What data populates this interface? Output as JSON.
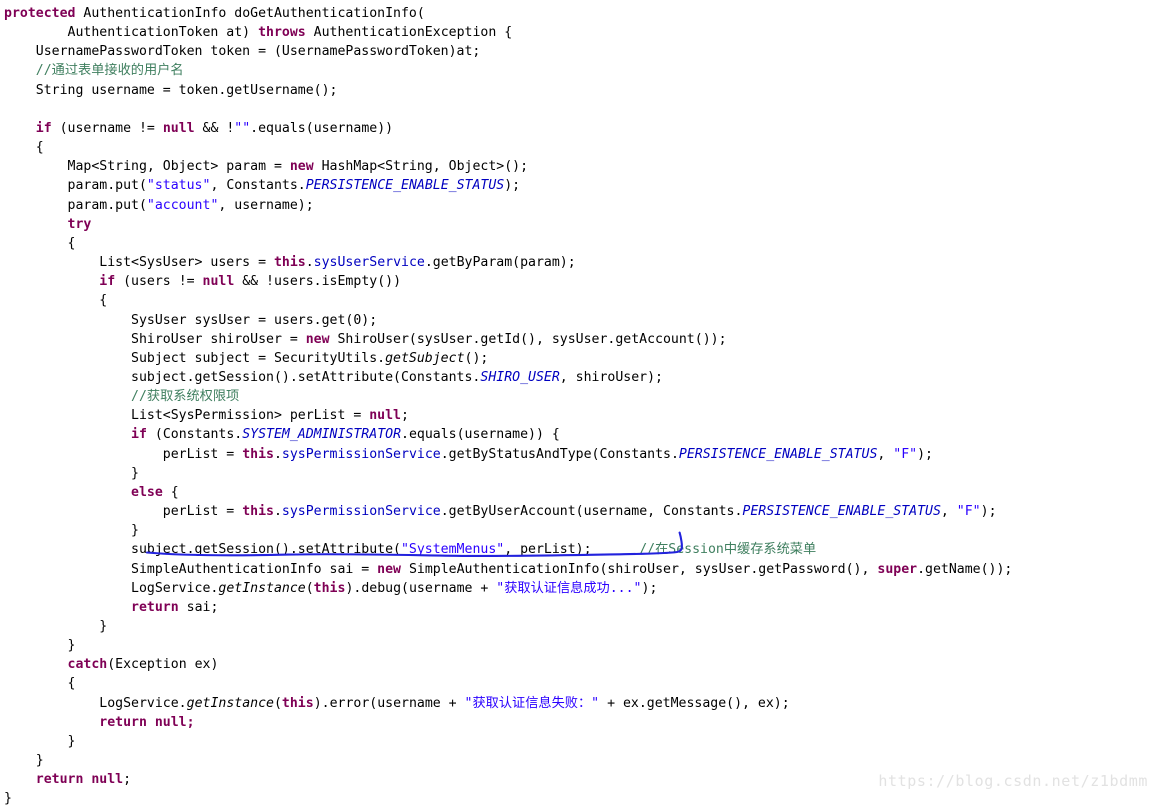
{
  "editor": {
    "language": "java",
    "background_color": "#ffffff",
    "default_text_color": "#000000",
    "theme": {
      "keyword_color": "#7F0055",
      "string_color": "#2A00FF",
      "comment_color": "#3F7F5F",
      "field_color": "#0000C0",
      "static_constant_color": "#0000C0"
    }
  },
  "annotation": {
    "ink_color": "#2222dd",
    "target_line_index": 28,
    "target_line_text": "subject.getSession().setAttribute(\"SystemMenus\", perList);",
    "shape": "hand-drawn-underline"
  },
  "watermark": {
    "text": "https://blog.csdn.net/z1bdmm",
    "color": "#e2e2e2"
  },
  "code": {
    "lines": [
      [
        {
          "t": "protected",
          "c": "kw"
        },
        {
          "t": " AuthenticationInfo doGetAuthenticationInfo(",
          "c": "plain"
        }
      ],
      [
        {
          "t": "        AuthenticationToken at) ",
          "c": "plain"
        },
        {
          "t": "throws",
          "c": "kw"
        },
        {
          "t": " AuthenticationException {",
          "c": "plain"
        }
      ],
      [
        {
          "t": "    UsernamePasswordToken token = (UsernamePasswordToken)at;",
          "c": "plain"
        }
      ],
      [
        {
          "t": "    //通过表单接收的用户名",
          "c": "cmt"
        }
      ],
      [
        {
          "t": "    String username = token.getUsername();",
          "c": "plain"
        }
      ],
      [
        {
          "t": "",
          "c": "plain"
        }
      ],
      [
        {
          "t": "    ",
          "c": "plain"
        },
        {
          "t": "if",
          "c": "kw"
        },
        {
          "t": " (username != ",
          "c": "plain"
        },
        {
          "t": "null",
          "c": "kw"
        },
        {
          "t": " && !",
          "c": "plain"
        },
        {
          "t": "\"\"",
          "c": "str"
        },
        {
          "t": ".equals(username))",
          "c": "plain"
        }
      ],
      [
        {
          "t": "    {",
          "c": "plain"
        }
      ],
      [
        {
          "t": "        Map<String, Object> param = ",
          "c": "plain"
        },
        {
          "t": "new",
          "c": "kw"
        },
        {
          "t": " HashMap<String, Object>();",
          "c": "plain"
        }
      ],
      [
        {
          "t": "        param.put(",
          "c": "plain"
        },
        {
          "t": "\"status\"",
          "c": "str"
        },
        {
          "t": ", Constants.",
          "c": "plain"
        },
        {
          "t": "PERSISTENCE_ENABLE_STATUS",
          "c": "cnst"
        },
        {
          "t": ");",
          "c": "plain"
        }
      ],
      [
        {
          "t": "        param.put(",
          "c": "plain"
        },
        {
          "t": "\"account\"",
          "c": "str"
        },
        {
          "t": ", username);",
          "c": "plain"
        }
      ],
      [
        {
          "t": "        ",
          "c": "plain"
        },
        {
          "t": "try",
          "c": "kw"
        }
      ],
      [
        {
          "t": "        {",
          "c": "plain"
        }
      ],
      [
        {
          "t": "            List<SysUser> users = ",
          "c": "plain"
        },
        {
          "t": "this",
          "c": "kw"
        },
        {
          "t": ".",
          "c": "plain"
        },
        {
          "t": "sysUserService",
          "c": "fld"
        },
        {
          "t": ".getByParam(param);",
          "c": "plain"
        }
      ],
      [
        {
          "t": "            ",
          "c": "plain"
        },
        {
          "t": "if",
          "c": "kw"
        },
        {
          "t": " (users != ",
          "c": "plain"
        },
        {
          "t": "null",
          "c": "kw"
        },
        {
          "t": " && !users.isEmpty())",
          "c": "plain"
        }
      ],
      [
        {
          "t": "            {",
          "c": "plain"
        }
      ],
      [
        {
          "t": "                SysUser sysUser = users.get(0);",
          "c": "plain"
        }
      ],
      [
        {
          "t": "                ShiroUser shiroUser = ",
          "c": "plain"
        },
        {
          "t": "new",
          "c": "kw"
        },
        {
          "t": " ShiroUser(sysUser.getId(), sysUser.getAccount());",
          "c": "plain"
        }
      ],
      [
        {
          "t": "                Subject subject = SecurityUtils.",
          "c": "plain"
        },
        {
          "t": "getSubject",
          "c": "stmeth"
        },
        {
          "t": "();",
          "c": "plain"
        }
      ],
      [
        {
          "t": "                subject.getSession().setAttribute(Constants.",
          "c": "plain"
        },
        {
          "t": "SHIRO_USER",
          "c": "cnst"
        },
        {
          "t": ", shiroUser);",
          "c": "plain"
        }
      ],
      [
        {
          "t": "                //获取系统权限项",
          "c": "cmt"
        }
      ],
      [
        {
          "t": "                List<SysPermission> perList = ",
          "c": "plain"
        },
        {
          "t": "null",
          "c": "kw"
        },
        {
          "t": ";",
          "c": "plain"
        }
      ],
      [
        {
          "t": "                ",
          "c": "plain"
        },
        {
          "t": "if",
          "c": "kw"
        },
        {
          "t": " (Constants.",
          "c": "plain"
        },
        {
          "t": "SYSTEM_ADMINISTRATOR",
          "c": "cnst"
        },
        {
          "t": ".equals(username)) {",
          "c": "plain"
        }
      ],
      [
        {
          "t": "                    perList = ",
          "c": "plain"
        },
        {
          "t": "this",
          "c": "kw"
        },
        {
          "t": ".",
          "c": "plain"
        },
        {
          "t": "sysPermissionService",
          "c": "fld"
        },
        {
          "t": ".getByStatusAndType(Constants.",
          "c": "plain"
        },
        {
          "t": "PERSISTENCE_ENABLE_STATUS",
          "c": "cnst"
        },
        {
          "t": ", ",
          "c": "plain"
        },
        {
          "t": "\"F\"",
          "c": "str"
        },
        {
          "t": ");",
          "c": "plain"
        }
      ],
      [
        {
          "t": "                }",
          "c": "plain"
        }
      ],
      [
        {
          "t": "                ",
          "c": "plain"
        },
        {
          "t": "else",
          "c": "kw"
        },
        {
          "t": " {",
          "c": "plain"
        }
      ],
      [
        {
          "t": "                    perList = ",
          "c": "plain"
        },
        {
          "t": "this",
          "c": "kw"
        },
        {
          "t": ".",
          "c": "plain"
        },
        {
          "t": "sysPermissionService",
          "c": "fld"
        },
        {
          "t": ".getByUserAccount(username, Constants.",
          "c": "plain"
        },
        {
          "t": "PERSISTENCE_ENABLE_STATUS",
          "c": "cnst"
        },
        {
          "t": ", ",
          "c": "plain"
        },
        {
          "t": "\"F\"",
          "c": "str"
        },
        {
          "t": ");",
          "c": "plain"
        }
      ],
      [
        {
          "t": "                }",
          "c": "plain"
        }
      ],
      [
        {
          "t": "                subject.getSession().setAttribute(",
          "c": "plain"
        },
        {
          "t": "\"SystemMenus\"",
          "c": "str"
        },
        {
          "t": ", perList);      ",
          "c": "plain"
        },
        {
          "t": "//在Session中缓存系统菜单",
          "c": "cmt"
        }
      ],
      [
        {
          "t": "                SimpleAuthenticationInfo sai = ",
          "c": "plain"
        },
        {
          "t": "new",
          "c": "kw"
        },
        {
          "t": " SimpleAuthenticationInfo(shiroUser, sysUser.getPassword(), ",
          "c": "plain"
        },
        {
          "t": "super",
          "c": "kw"
        },
        {
          "t": ".getName());",
          "c": "plain"
        }
      ],
      [
        {
          "t": "                LogService.",
          "c": "plain"
        },
        {
          "t": "getInstance",
          "c": "stmeth"
        },
        {
          "t": "(",
          "c": "plain"
        },
        {
          "t": "this",
          "c": "kw"
        },
        {
          "t": ").debug(username + ",
          "c": "plain"
        },
        {
          "t": "\"获取认证信息成功...\"",
          "c": "str"
        },
        {
          "t": ");",
          "c": "plain"
        }
      ],
      [
        {
          "t": "                ",
          "c": "plain"
        },
        {
          "t": "return",
          "c": "kw"
        },
        {
          "t": " sai;",
          "c": "plain"
        }
      ],
      [
        {
          "t": "            }",
          "c": "plain"
        }
      ],
      [
        {
          "t": "        }",
          "c": "plain"
        }
      ],
      [
        {
          "t": "        ",
          "c": "plain"
        },
        {
          "t": "catch",
          "c": "kw"
        },
        {
          "t": "(Exception ex)",
          "c": "plain"
        }
      ],
      [
        {
          "t": "        {",
          "c": "plain"
        }
      ],
      [
        {
          "t": "            LogService.",
          "c": "plain"
        },
        {
          "t": "getInstance",
          "c": "stmeth"
        },
        {
          "t": "(",
          "c": "plain"
        },
        {
          "t": "this",
          "c": "kw"
        },
        {
          "t": ").error(username + ",
          "c": "plain"
        },
        {
          "t": "\"获取认证信息失败：\"",
          "c": "str"
        },
        {
          "t": " + ex.getMessage(), ex);",
          "c": "plain"
        }
      ],
      [
        {
          "t": "            ",
          "c": "plain"
        },
        {
          "t": "return",
          "c": "kw"
        },
        {
          "t": " null;",
          "c": "kw"
        }
      ],
      [
        {
          "t": "        }",
          "c": "plain"
        }
      ],
      [
        {
          "t": "    }",
          "c": "plain"
        }
      ],
      [
        {
          "t": "    ",
          "c": "plain"
        },
        {
          "t": "return",
          "c": "kw"
        },
        {
          "t": " ",
          "c": "plain"
        },
        {
          "t": "null",
          "c": "kw"
        },
        {
          "t": ";",
          "c": "plain"
        }
      ],
      [
        {
          "t": "}",
          "c": "plain"
        }
      ]
    ]
  }
}
